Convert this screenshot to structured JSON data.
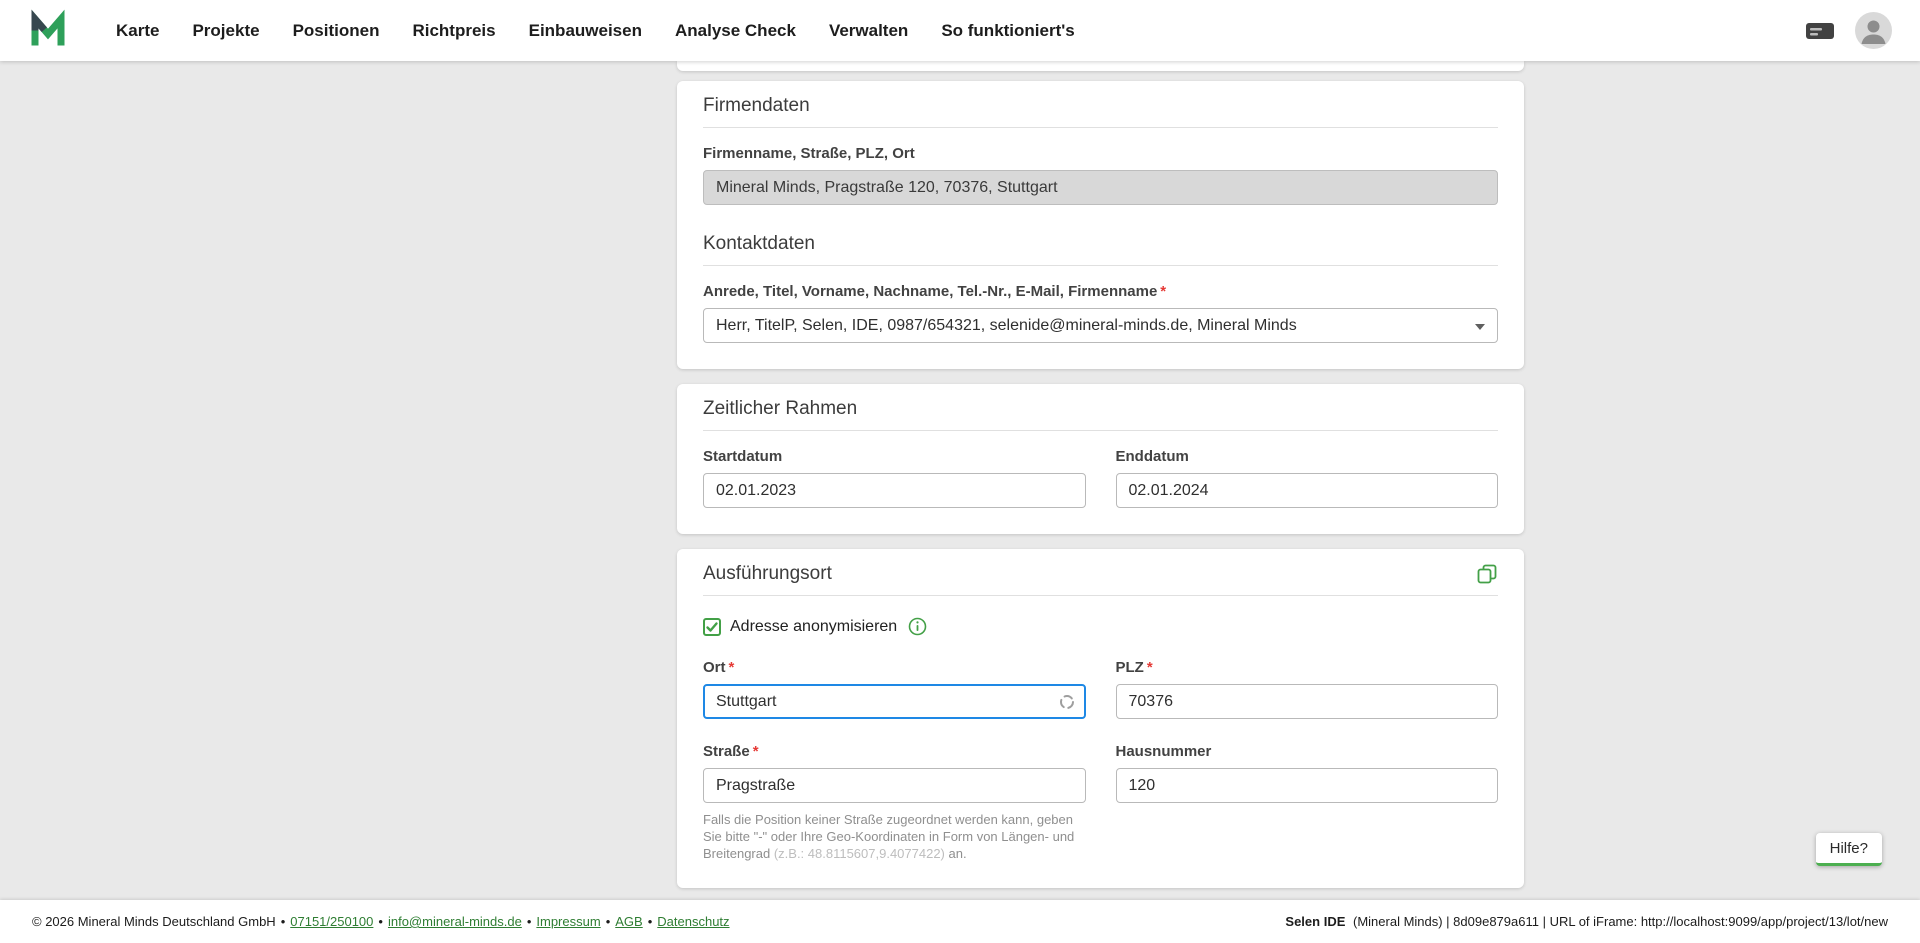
{
  "ui": {
    "required_marker": "*",
    "separator": "•"
  },
  "navbar": {
    "items": [
      "Karte",
      "Projekte",
      "Positionen",
      "Richtpreis",
      "Einbauweisen",
      "Analyse Check",
      "Verwalten",
      "So funktioniert's"
    ]
  },
  "cards": {
    "firmendaten": {
      "title": "Firmendaten",
      "company_label": "Firmenname, Straße, PLZ, Ort",
      "company_value": "Mineral Minds, Pragstraße 120, 70376, Stuttgart",
      "contact_title": "Kontaktdaten",
      "contact_label": "Anrede, Titel, Vorname, Nachname, Tel.-Nr., E-Mail, Firmenname",
      "contact_value": "Herr, TitelP, Selen, IDE, 0987/654321, selenide@mineral-minds.de, Mineral Minds"
    },
    "zeitlicher_rahmen": {
      "title": "Zeitlicher Rahmen",
      "startdatum_label": "Startdatum",
      "startdatum_value": "02.01.2023",
      "enddatum_label": "Enddatum",
      "enddatum_value": "02.01.2024"
    },
    "ausfuehrungsort": {
      "title": "Ausführungsort",
      "anonymize_label": "Adresse anonymisieren",
      "ort_label": "Ort",
      "ort_value": "Stuttgart",
      "plz_label": "PLZ",
      "plz_value": "70376",
      "strasse_label": "Straße",
      "strasse_value": "Pragstraße",
      "hausnummer_label": "Hausnummer",
      "hausnummer_value": "120",
      "hint_part1": "Falls die Position keiner Straße zugeordnet werden kann, geben Sie bitte \"-\" oder Ihre Geo-Koordinaten in Form von Längen- und Breitengrad ",
      "hint_coords": "(z.B.: 48.8115607,9.4077422)",
      "hint_part2": " an."
    }
  },
  "help_button_label": "Hilfe?",
  "footer": {
    "copyright": "© 2026 Mineral Minds Deutschland GmbH",
    "links": [
      "07151/250100",
      "info@mineral-minds.de",
      "Impressum",
      "AGB",
      "Datenschutz"
    ],
    "right_app": "Selen IDE",
    "right_info": "(Mineral Minds) | 8d09e879a611 | URL of iFrame: http://localhost:9099/app/project/13/lot/new"
  },
  "colors": {
    "brand_green": "#2ea05a",
    "accent_green": "#43a047",
    "focus_blue": "#1e88e5",
    "link_green": "#2e7d32",
    "required_red": "#e53935"
  }
}
